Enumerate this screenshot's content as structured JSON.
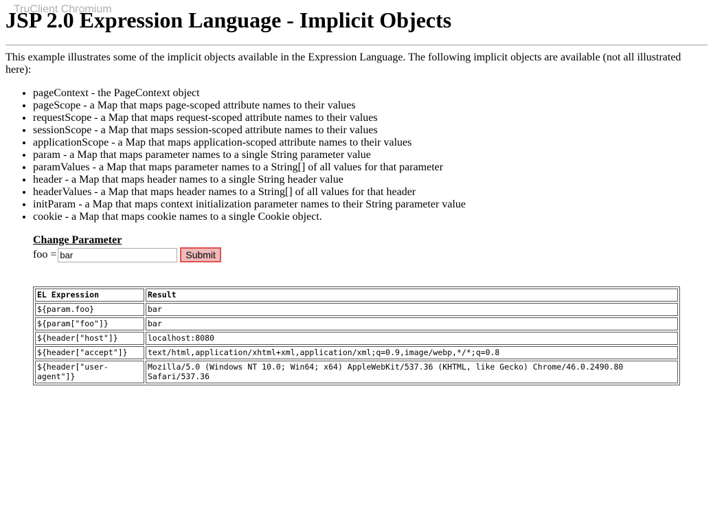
{
  "watermark": "TruClient Chromium",
  "page": {
    "title": "JSP 2.0 Expression Language - Implicit Objects",
    "intro": "This example illustrates some of the implicit objects available in the Expression Language. The following implicit objects are available (not all illustrated here):"
  },
  "implicit_objects": [
    "pageContext - the PageContext object",
    "pageScope - a Map that maps page-scoped attribute names to their values",
    "requestScope - a Map that maps request-scoped attribute names to their values",
    "sessionScope - a Map that maps session-scoped attribute names to their values",
    "applicationScope - a Map that maps application-scoped attribute names to their values",
    "param - a Map that maps parameter names to a single String parameter value",
    "paramValues - a Map that maps parameter names to a String[] of all values for that parameter",
    "header - a Map that maps header names to a single String header value",
    "headerValues - a Map that maps header names to a String[] of all values for that header",
    "initParam - a Map that maps context initialization parameter names to their String parameter value",
    "cookie - a Map that maps cookie names to a single Cookie object."
  ],
  "form": {
    "title": "Change Parameter",
    "field_label": "foo =",
    "field_value": "bar",
    "submit_label": "Submit"
  },
  "table": {
    "headers": [
      "EL Expression",
      "Result"
    ],
    "rows": [
      [
        "${param.foo}",
        "bar"
      ],
      [
        "${param[\"foo\"]}",
        "bar"
      ],
      [
        "${header[\"host\"]}",
        "localhost:8080"
      ],
      [
        "${header[\"accept\"]}",
        "text/html,application/xhtml+xml,application/xml;q=0.9,image/webp,*/*;q=0.8"
      ],
      [
        "${header[\"user-agent\"]}",
        "Mozilla/5.0 (Windows NT 10.0; Win64; x64) AppleWebKit/537.36 (KHTML, like Gecko) Chrome/46.0.2490.80 Safari/537.36"
      ]
    ]
  }
}
